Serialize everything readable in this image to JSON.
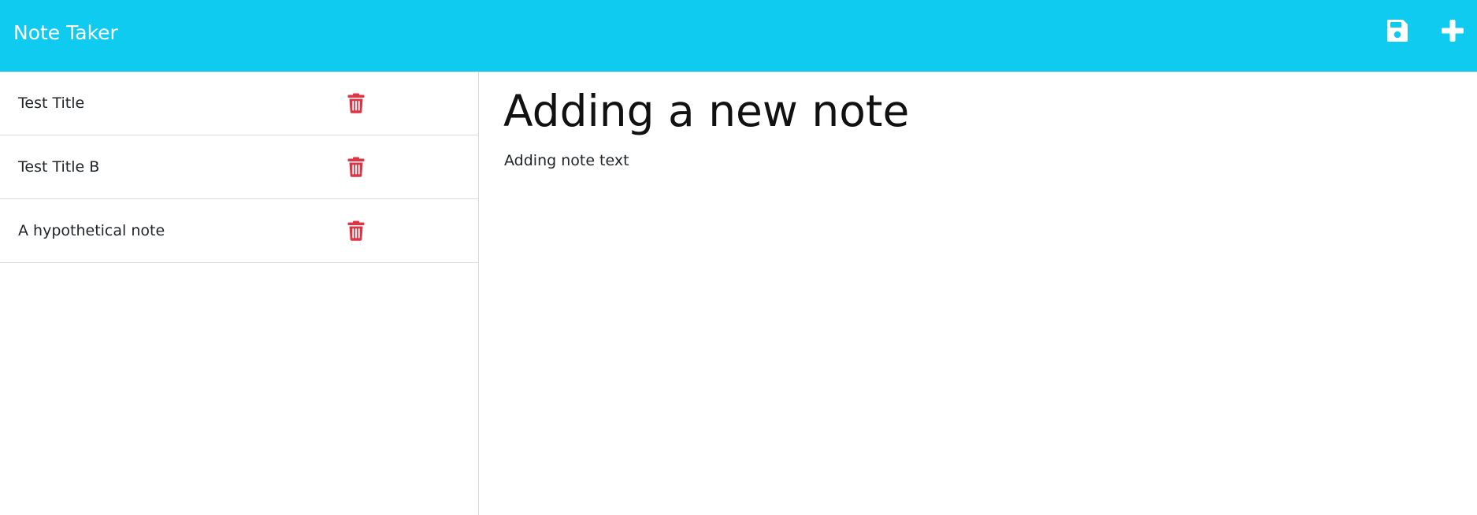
{
  "header": {
    "title": "Note Taker",
    "save_icon": "save-icon",
    "new_icon": "plus-icon",
    "background_color": "#0fcbef"
  },
  "sidebar": {
    "notes": [
      {
        "title": "Test Title"
      },
      {
        "title": "Test Title B"
      },
      {
        "title": "A hypothetical note"
      }
    ],
    "delete_icon": "trash-icon",
    "delete_color": "#dc3545"
  },
  "editor": {
    "title_value": "Adding a new note",
    "text_value": "Adding note text"
  }
}
